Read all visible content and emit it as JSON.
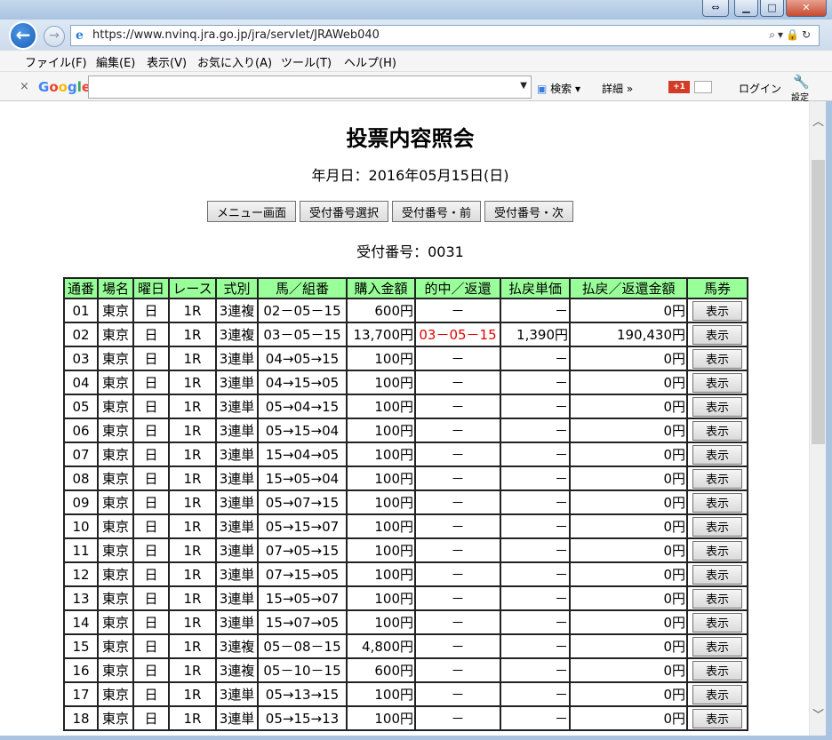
{
  "browser": {
    "url": "https://www.nvinq.jra.go.jp/jra/servlet/JRAWeb040",
    "menu": [
      "ファイル(F)",
      "編集(E)",
      "表示(V)",
      "お気に入り(A)",
      "ツール(T)",
      "ヘルプ(H)"
    ],
    "google_toolbar": {
      "close_glyph": "×",
      "logo": "Google",
      "search_label": "検索",
      "details_label": "詳細 »",
      "plus_label": "+1",
      "login_label": "ログイン",
      "settings_label": "設定"
    }
  },
  "page": {
    "title": "投票内容照会",
    "date_line": "年月日：2016年05月15日(日)",
    "nav_buttons": [
      "メニュー画面",
      "受付番号選択",
      "受付番号・前",
      "受付番号・次"
    ],
    "ticket_line": "受付番号：0031"
  },
  "table": {
    "headers": [
      "通番",
      "場名",
      "曜日",
      "レース",
      "式別",
      "馬／組番",
      "購入金額",
      "的中／返還",
      "払戻単価",
      "払戻／返還金額",
      "馬券"
    ],
    "show_label": "表示",
    "rows": [
      [
        "01",
        "東京",
        "日",
        "1R",
        "3連複",
        "02－05－15",
        "600円",
        "－",
        "－",
        "0円"
      ],
      [
        "02",
        "東京",
        "日",
        "1R",
        "3連複",
        "03－05－15",
        "13,700円",
        "03－05－15",
        "1,390円",
        "190,430円"
      ],
      [
        "03",
        "東京",
        "日",
        "1R",
        "3連単",
        "04→05→15",
        "100円",
        "－",
        "－",
        "0円"
      ],
      [
        "04",
        "東京",
        "日",
        "1R",
        "3連単",
        "04→15→05",
        "100円",
        "－",
        "－",
        "0円"
      ],
      [
        "05",
        "東京",
        "日",
        "1R",
        "3連単",
        "05→04→15",
        "100円",
        "－",
        "－",
        "0円"
      ],
      [
        "06",
        "東京",
        "日",
        "1R",
        "3連単",
        "05→15→04",
        "100円",
        "－",
        "－",
        "0円"
      ],
      [
        "07",
        "東京",
        "日",
        "1R",
        "3連単",
        "15→04→05",
        "100円",
        "－",
        "－",
        "0円"
      ],
      [
        "08",
        "東京",
        "日",
        "1R",
        "3連単",
        "15→05→04",
        "100円",
        "－",
        "－",
        "0円"
      ],
      [
        "09",
        "東京",
        "日",
        "1R",
        "3連単",
        "05→07→15",
        "100円",
        "－",
        "－",
        "0円"
      ],
      [
        "10",
        "東京",
        "日",
        "1R",
        "3連単",
        "05→15→07",
        "100円",
        "－",
        "－",
        "0円"
      ],
      [
        "11",
        "東京",
        "日",
        "1R",
        "3連単",
        "07→05→15",
        "100円",
        "－",
        "－",
        "0円"
      ],
      [
        "12",
        "東京",
        "日",
        "1R",
        "3連単",
        "07→15→05",
        "100円",
        "－",
        "－",
        "0円"
      ],
      [
        "13",
        "東京",
        "日",
        "1R",
        "3連単",
        "15→05→07",
        "100円",
        "－",
        "－",
        "0円"
      ],
      [
        "14",
        "東京",
        "日",
        "1R",
        "3連単",
        "15→07→05",
        "100円",
        "－",
        "－",
        "0円"
      ],
      [
        "15",
        "東京",
        "日",
        "1R",
        "3連複",
        "05－08－15",
        "4,800円",
        "－",
        "－",
        "0円"
      ],
      [
        "16",
        "東京",
        "日",
        "1R",
        "3連複",
        "05－10－15",
        "600円",
        "－",
        "－",
        "0円"
      ],
      [
        "17",
        "東京",
        "日",
        "1R",
        "3連単",
        "05→13→15",
        "100円",
        "－",
        "－",
        "0円"
      ],
      [
        "18",
        "東京",
        "日",
        "1R",
        "3連単",
        "05→15→13",
        "100円",
        "－",
        "－",
        "0円"
      ]
    ],
    "hit_row_index": 1,
    "hit_color": "#e00000",
    "header_bg": "#99ff99"
  }
}
